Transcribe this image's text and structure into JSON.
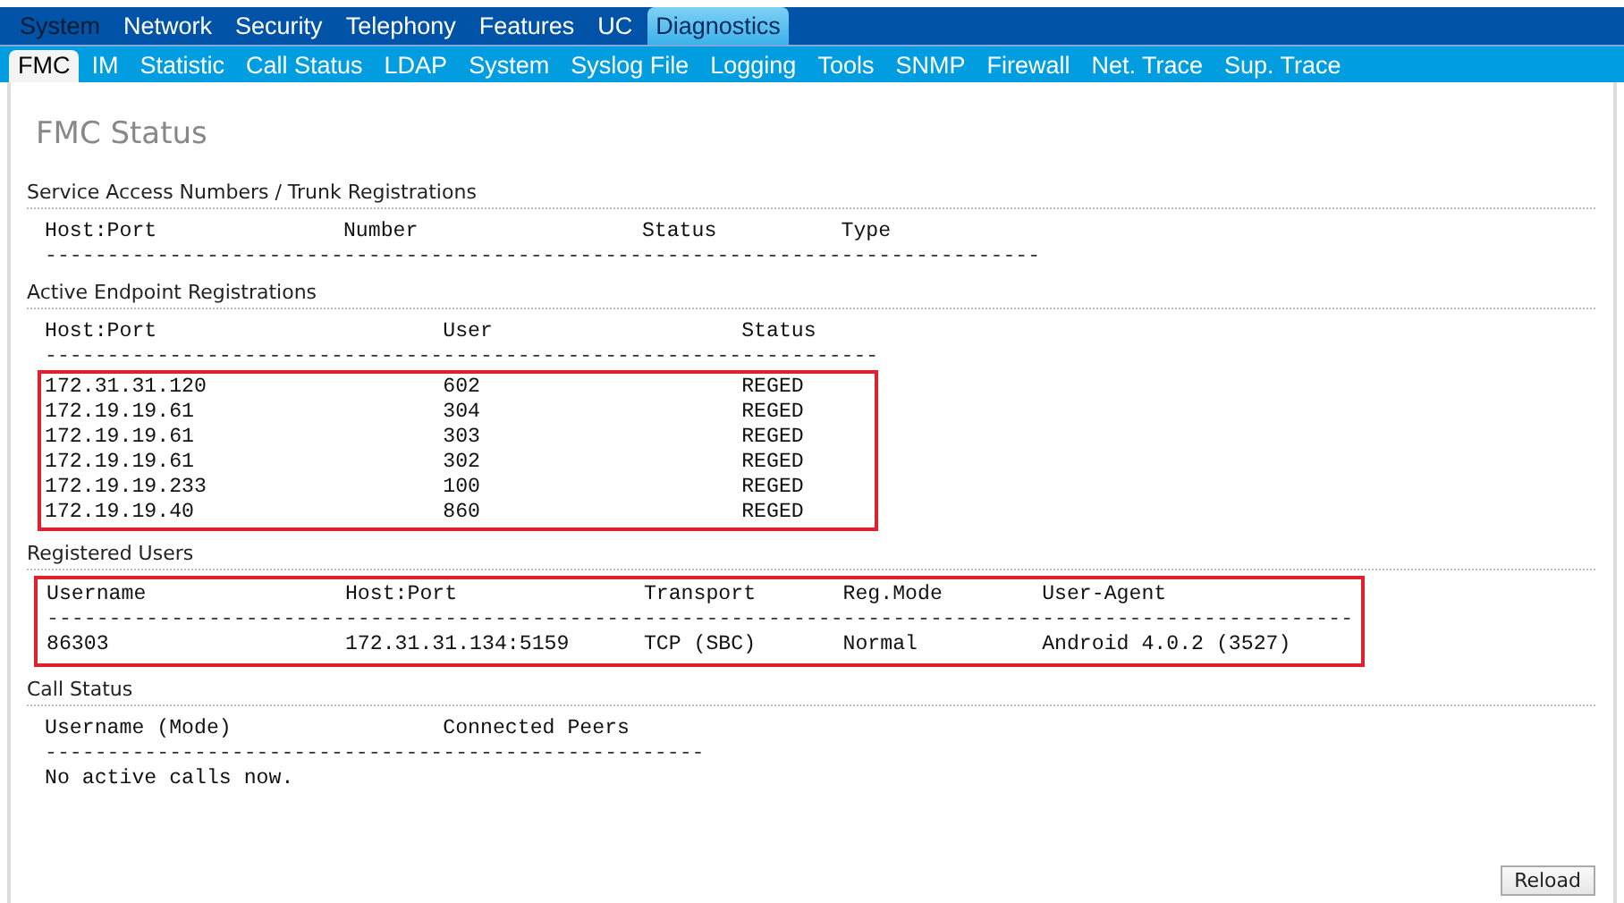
{
  "top_menu": [
    {
      "label": "System",
      "selected": false
    },
    {
      "label": "Network",
      "selected": false
    },
    {
      "label": "Security",
      "selected": false
    },
    {
      "label": "Telephony",
      "selected": false
    },
    {
      "label": "Features",
      "selected": false
    },
    {
      "label": "UC",
      "selected": false
    },
    {
      "label": "Diagnostics",
      "selected": true
    }
  ],
  "sub_tabs": [
    {
      "label": "FMC",
      "selected": true
    },
    {
      "label": "IM",
      "selected": false
    },
    {
      "label": "Statistic",
      "selected": false
    },
    {
      "label": "Call Status",
      "selected": false
    },
    {
      "label": "LDAP",
      "selected": false
    },
    {
      "label": "System",
      "selected": false
    },
    {
      "label": "Syslog File",
      "selected": false
    },
    {
      "label": "Logging",
      "selected": false
    },
    {
      "label": "Tools",
      "selected": false
    },
    {
      "label": "SNMP",
      "selected": false
    },
    {
      "label": "Firewall",
      "selected": false
    },
    {
      "label": "Net. Trace",
      "selected": false
    },
    {
      "label": "Sup. Trace",
      "selected": false
    }
  ],
  "page_title": "FMC Status",
  "sections": [
    {
      "title": "Service Access Numbers / Trunk Registrations",
      "columns": [
        "Host:Port",
        "Number",
        "Status",
        "Type"
      ],
      "separator": "--------------------------------------------------------------------------------"
    },
    {
      "title": "Active Endpoint Registrations",
      "rows_framed": true,
      "columns": [
        "Host:Port",
        "User",
        "Status"
      ],
      "separator": "-------------------------------------------------------------------",
      "rows": [
        [
          "172.31.31.120",
          "602",
          "REGED"
        ],
        [
          "172.19.19.61",
          "304",
          "REGED"
        ],
        [
          "172.19.19.61",
          "303",
          "REGED"
        ],
        [
          "172.19.19.61",
          "302",
          "REGED"
        ],
        [
          "172.19.19.233",
          "100",
          "REGED"
        ],
        [
          "172.19.19.40",
          "860",
          "REGED"
        ]
      ]
    },
    {
      "title": "Registered Users",
      "table_framed": true,
      "columns": [
        "Username",
        "Host:Port",
        "Transport",
        "Reg.Mode",
        "User-Agent"
      ],
      "separator": "---------------------------------------------------------------------------------------------------------",
      "rows": [
        [
          "86303",
          "172.31.31.134:5159",
          "TCP (SBC)",
          "Normal",
          "Android 4.0.2 (3527)"
        ]
      ]
    },
    {
      "title": "Call Status",
      "columns": [
        "Username (Mode)",
        "Connected Peers"
      ],
      "separator": "-----------------------------------------------------",
      "message": "No active calls now."
    }
  ],
  "reload_button": "Reload"
}
